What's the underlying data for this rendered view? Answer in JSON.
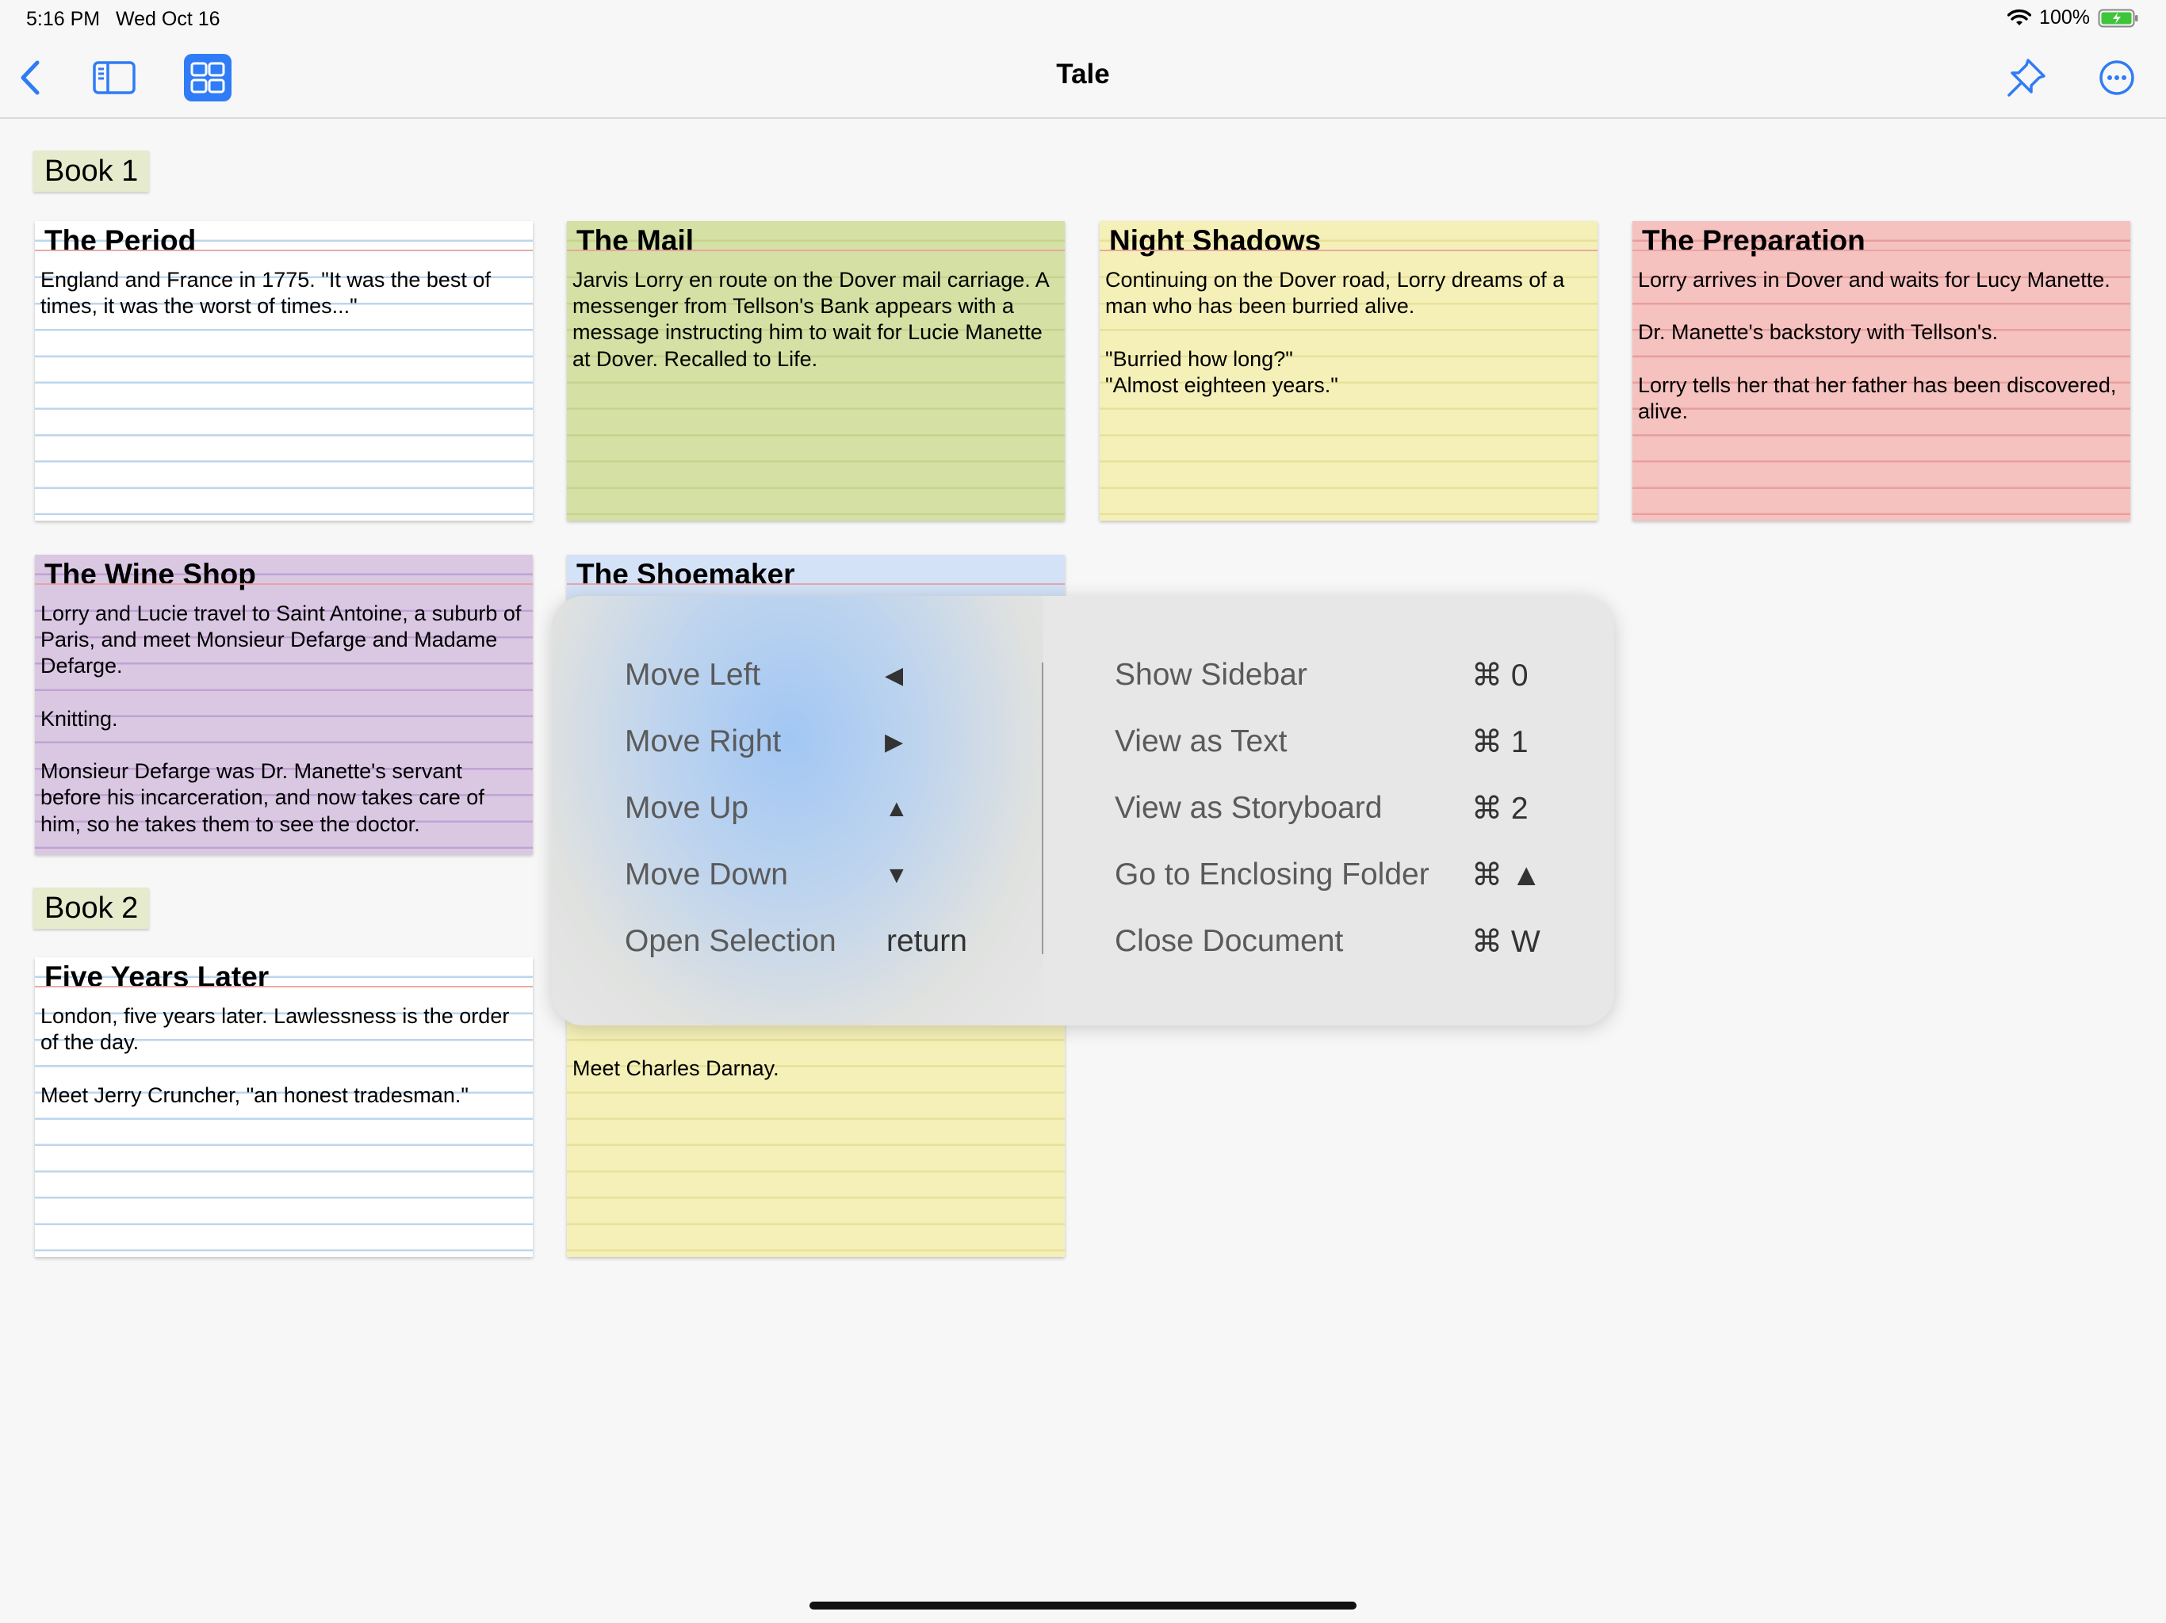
{
  "status": {
    "time": "5:16 PM",
    "date": "Wed Oct 16",
    "battery": "100%"
  },
  "nav": {
    "title": "Tale",
    "back_icon": "chevron-left-icon",
    "sidebar_icon": "sidebar-icon",
    "grid_icon": "grid-icon",
    "pin_icon": "pushpin-icon",
    "more_icon": "ellipsis-circle-icon"
  },
  "sections": [
    {
      "label": "Book 1"
    },
    {
      "label": "Book 2"
    }
  ],
  "cards": [
    {
      "title": "The Period",
      "body": "England and France in 1775. \"It was the best of times, it was the worst of times...\"",
      "color": "#ffffff"
    },
    {
      "title": "The Mail",
      "body": "Jarvis Lorry en route on the Dover mail carriage. A messenger from Tellson's Bank appears with a message instructing him to wait for Lucie Manette at Dover. Recalled to Life.",
      "color": "#d5e0a4"
    },
    {
      "title": "Night Shadows",
      "body": "Continuing on the Dover road, Lorry dreams of a man who has been burried alive.\n\n\"Burried how long?\"\n\"Almost eighteen years.\"",
      "color": "#f5f0b8"
    },
    {
      "title": "The Preparation",
      "body": "Lorry arrives in Dover and waits for Lucy Manette.\n\nDr. Manette's backstory with Tellson's.\n\nLorry tells her that her father has been discovered, alive.",
      "color": "#f5c2c0"
    },
    {
      "title": "The Wine Shop",
      "body": "Lorry and Lucie travel to Saint Antoine, a suburb of Paris, and meet Monsieur Defarge and Madame Defarge.\n\nKnitting.\n\nMonsieur Defarge was Dr. Manette's servant before his incarceration, and now takes care of him, so he takes them to see the doctor.",
      "color": "#dac8e3"
    },
    {
      "title": "The Shoemaker",
      "body": "",
      "color": "#d3e2f7"
    },
    {
      "title": "Five Years Later",
      "body": "London, five years later. Lawlessness is the order of the day.\n\nMeet Jerry Cruncher, \"an honest tradesman.\"",
      "color": "#ffffff"
    },
    {
      "title": "",
      "body": "about the nature of the trial.\n\nMeet Charles Darnay.",
      "color": "#f5f0b8"
    }
  ],
  "shortcuts": {
    "left": [
      {
        "label": "Move Left",
        "key": "◀"
      },
      {
        "label": "Move Right",
        "key": "▶"
      },
      {
        "label": "Move Up",
        "key": "▲"
      },
      {
        "label": "Move Down",
        "key": "▼"
      },
      {
        "label": "Open Selection",
        "key": "return"
      }
    ],
    "right": [
      {
        "label": "Show Sidebar",
        "key": "⌘ 0"
      },
      {
        "label": "View as Text",
        "key": "⌘ 1"
      },
      {
        "label": "View as Storyboard",
        "key": "⌘ 2"
      },
      {
        "label": "Go to Enclosing Folder",
        "key": "⌘ ▲"
      },
      {
        "label": "Close Document",
        "key": "⌘ W"
      }
    ]
  }
}
